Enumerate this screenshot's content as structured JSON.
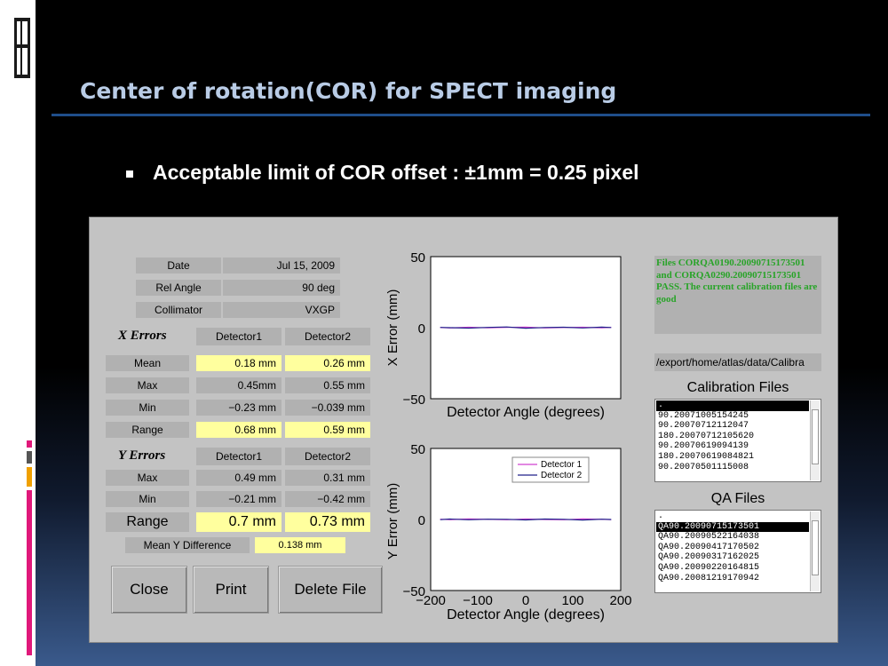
{
  "slide": {
    "title": "Center of rotation(COR) for SPECT imaging",
    "bullet": "Acceptable limit of COR offset  :  ±1mm  =  0.25 pixel"
  },
  "colors": {
    "title": "#b9cce6",
    "rule": "#1f4e8a",
    "highlight": "#ffff9e",
    "pass_text": "#28a428",
    "detector1": "#d040d0",
    "detector2": "#20208a"
  },
  "info": {
    "date_label": "Date",
    "date_value": "Jul 15, 2009",
    "angle_label": "Rel Angle",
    "angle_value": "90 deg",
    "collimator_label": "Collimator",
    "collimator_value": "VXGP"
  },
  "x_errors": {
    "title": "X Errors",
    "col1": "Detector1",
    "col2": "Detector2",
    "rows": [
      {
        "label": "Mean",
        "d1": "0.18 mm",
        "d2": "0.26 mm"
      },
      {
        "label": "Max",
        "d1": "0.45mm",
        "d2": "0.55 mm"
      },
      {
        "label": "Min",
        "d1": "−0.23 mm",
        "d2": "−0.039 mm"
      },
      {
        "label": "Range",
        "d1": "0.68 mm",
        "d2": "0.59 mm"
      }
    ]
  },
  "y_errors": {
    "title": "Y Errors",
    "col1": "Detector1",
    "col2": "Detector2",
    "rows": [
      {
        "label": "Max",
        "d1": "0.49 mm",
        "d2": "0.31 mm"
      },
      {
        "label": "Min",
        "d1": "−0.21 mm",
        "d2": "−0.42 mm"
      },
      {
        "label": "Range",
        "d1": "0.7 mm",
        "d2": "0.73 mm"
      }
    ],
    "mean_diff_label": "Mean Y Difference",
    "mean_diff_value": "0.138 mm"
  },
  "buttons": {
    "close": "Close",
    "print": "Print",
    "delete": "Delete File"
  },
  "plots": {
    "x_plot": {
      "ylabel": "X Error (mm)",
      "xlabel": "Detector Angle (degrees)",
      "ytick_top": "50",
      "ytick_mid": "0",
      "ytick_bottom": "−50"
    },
    "y_plot": {
      "ylabel": "Y Error (mm)",
      "xlabel": "Detector Angle (degrees)",
      "ytick_top": "50",
      "ytick_mid": "0",
      "ytick_bottom": "−50",
      "xticks": [
        "−200",
        "−100",
        "0",
        "100",
        "200"
      ],
      "legend": [
        "Detector 1",
        "Detector 2"
      ]
    }
  },
  "status": {
    "message": "Files CORQA0190.20090715173501 and CORQA0290.20090715173501 PASS. The current calibration files are good",
    "path": "/export/home/atlas/data/Calibra"
  },
  "calibration_files": {
    "title": "Calibration Files",
    "items": [
      ".",
      "90.20071005154245",
      "90.20070712112047",
      "180.20070712105620",
      "90.20070619094139",
      "180.20070619084821",
      "90.20070501115008"
    ],
    "selected_index": 0
  },
  "qa_files": {
    "title": "QA Files",
    "items": [
      ".",
      "QA90.20090715173501",
      "QA90.20090522164038",
      "QA90.20090417170502",
      "QA90.20090317162025",
      "QA90.20090220164815",
      "QA90.20081219170942"
    ],
    "selected_index": 1
  },
  "chart_data": [
    {
      "type": "line",
      "ylabel": "X Error (mm)",
      "xlabel": "Detector Angle (degrees)",
      "xlim": [
        -200,
        200
      ],
      "ylim": [
        -50,
        50
      ],
      "x": [
        -180,
        -160,
        -120,
        -80,
        -40,
        0,
        40,
        80,
        120,
        160,
        180
      ],
      "series": [
        {
          "name": "Detector 1",
          "values": [
            0.1,
            -0.2,
            0.3,
            -0.1,
            0.2,
            0.4,
            -0.2,
            0.1,
            0.3,
            -0.1,
            0.2
          ]
        },
        {
          "name": "Detector 2",
          "values": [
            0.2,
            0.0,
            -0.3,
            0.2,
            0.5,
            -0.4,
            0.1,
            0.3,
            -0.2,
            0.4,
            0.1
          ]
        }
      ]
    },
    {
      "type": "line",
      "ylabel": "Y Error (mm)",
      "xlabel": "Detector Angle (degrees)",
      "xlim": [
        -200,
        200
      ],
      "ylim": [
        -50,
        50
      ],
      "x": [
        -180,
        -160,
        -120,
        -80,
        -40,
        0,
        40,
        80,
        120,
        160,
        180
      ],
      "series": [
        {
          "name": "Detector 1",
          "values": [
            0.2,
            -0.1,
            0.4,
            0.1,
            -0.2,
            0.3,
            0.0,
            -0.2,
            0.4,
            0.1,
            -0.1
          ]
        },
        {
          "name": "Detector 2",
          "values": [
            -0.1,
            0.3,
            -0.2,
            0.2,
            0.1,
            -0.3,
            0.3,
            0.1,
            -0.4,
            0.2,
            0.0
          ]
        }
      ]
    }
  ]
}
